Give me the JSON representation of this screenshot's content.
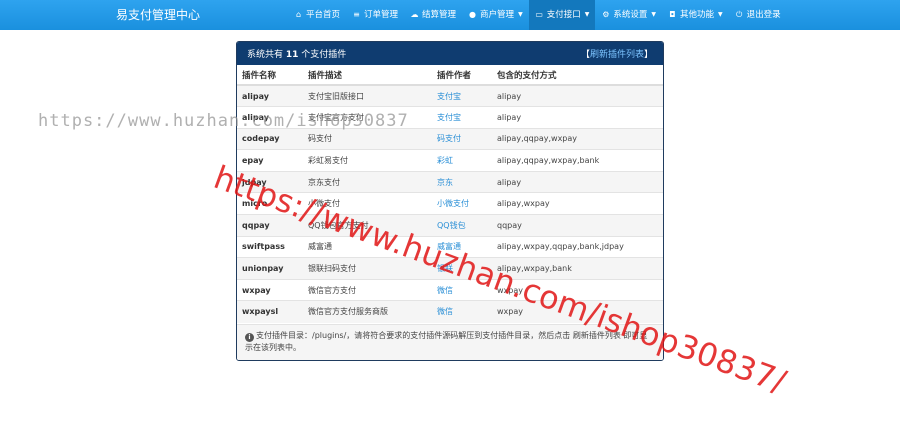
{
  "header": {
    "brand": "易支付管理中心",
    "nav": [
      {
        "icon": "home-icon",
        "glyph": "⌂",
        "label": "平台首页",
        "caret": false,
        "active": false
      },
      {
        "icon": "list-icon",
        "glyph": "≡",
        "label": "订单管理",
        "caret": false,
        "active": false
      },
      {
        "icon": "cloud-icon",
        "glyph": "☁",
        "label": "结算管理",
        "caret": false,
        "active": false
      },
      {
        "icon": "user-icon",
        "glyph": "●",
        "label": "商户管理",
        "caret": true,
        "active": false
      },
      {
        "icon": "credit-card-icon",
        "glyph": "▭",
        "label": "支付接口",
        "caret": true,
        "active": true
      },
      {
        "icon": "gear-icon",
        "glyph": "⚙",
        "label": "系统设置",
        "caret": true,
        "active": false
      },
      {
        "icon": "briefcase-icon",
        "glyph": "◘",
        "label": "其他功能",
        "caret": true,
        "active": false
      },
      {
        "icon": "power-icon",
        "glyph": "⏻",
        "label": "退出登录",
        "caret": false,
        "active": false
      }
    ]
  },
  "panel": {
    "prefix": "系统共有",
    "count": "11",
    "suffix": "个支付插件",
    "refresh": "刷新插件列表",
    "refresh_open": "【",
    "refresh_close": "】"
  },
  "table": {
    "headers": [
      "插件名称",
      "插件描述",
      "插件作者",
      "包含的支付方式"
    ],
    "rows": [
      {
        "name": "alipay",
        "desc": "支付宝旧版接口",
        "author": "支付宝",
        "types": "alipay"
      },
      {
        "name": "alipay",
        "desc": "支付宝官方支付",
        "author": "支付宝",
        "types": "alipay"
      },
      {
        "name": "codepay",
        "desc": "码支付",
        "author": "码支付",
        "types": "alipay,qqpay,wxpay"
      },
      {
        "name": "epay",
        "desc": "彩虹易支付",
        "author": "彩虹",
        "types": "alipay,qqpay,wxpay,bank"
      },
      {
        "name": "jdpay",
        "desc": "京东支付",
        "author": "京东",
        "types": "alipay"
      },
      {
        "name": "micro",
        "desc": "小微支付",
        "author": "小微支付",
        "types": "alipay,wxpay"
      },
      {
        "name": "qqpay",
        "desc": "QQ钱包官方支付",
        "author": "QQ钱包",
        "types": "qqpay"
      },
      {
        "name": "swiftpass",
        "desc": "威富通",
        "author": "威富通",
        "types": "alipay,wxpay,qqpay,bank,jdpay"
      },
      {
        "name": "unionpay",
        "desc": "银联扫码支付",
        "author": "银联",
        "types": "alipay,wxpay,bank"
      },
      {
        "name": "wxpay",
        "desc": "微信官方支付",
        "author": "微信",
        "types": "wxpay"
      },
      {
        "name": "wxpaysl",
        "desc": "微信官方支付服务商版",
        "author": "微信",
        "types": "wxpay"
      }
    ]
  },
  "footer": {
    "note": "支付插件目录：/plugins/，请将符合要求的支付插件源码解压到支付插件目录，然后点击 刷新插件列表 即可显示在该列表中。"
  },
  "watermark": {
    "grey": "https://www.huzhan.com/ishop30837",
    "red": "https://www.huzhan.com/ishop30837/"
  }
}
